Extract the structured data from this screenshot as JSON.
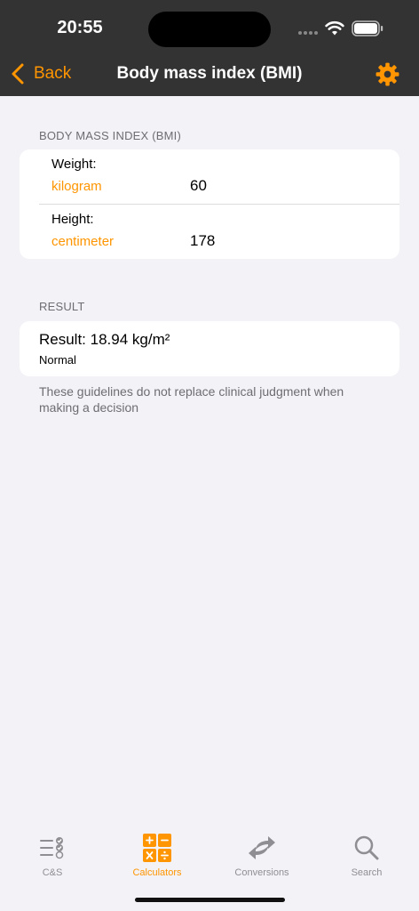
{
  "status_bar": {
    "time": "20:55",
    "icons": [
      "cellular-signal-icon",
      "wifi-icon",
      "battery-icon"
    ]
  },
  "nav": {
    "back_label": "Back",
    "title": "Body mass index (BMI)",
    "settings_icon": "gear-icon"
  },
  "colors": {
    "accent": "#ff9500",
    "nav_background": "#333333",
    "page_background": "#f2f2f7",
    "secondary_text": "#6d6d72"
  },
  "bmi_section": {
    "header": "BODY MASS INDEX (BMI)",
    "fields": [
      {
        "label": "Weight:",
        "unit": "kilogram",
        "value": "60"
      },
      {
        "label": "Height:",
        "unit": "centimeter",
        "value": "178"
      }
    ]
  },
  "result_section": {
    "header": "RESULT",
    "result": "Result: 18.94 kg/m²",
    "category": "Normal",
    "footnote": "These guidelines do not replace clinical judgment when making a decision"
  },
  "tabbar": {
    "tabs": [
      {
        "label": "C&S",
        "icon": "checklist-icon",
        "active": false
      },
      {
        "label": "Calculators",
        "icon": "calculator-icon",
        "active": true
      },
      {
        "label": "Conversions",
        "icon": "conversion-arrows-icon",
        "active": false
      },
      {
        "label": "Search",
        "icon": "search-icon",
        "active": false
      }
    ]
  }
}
